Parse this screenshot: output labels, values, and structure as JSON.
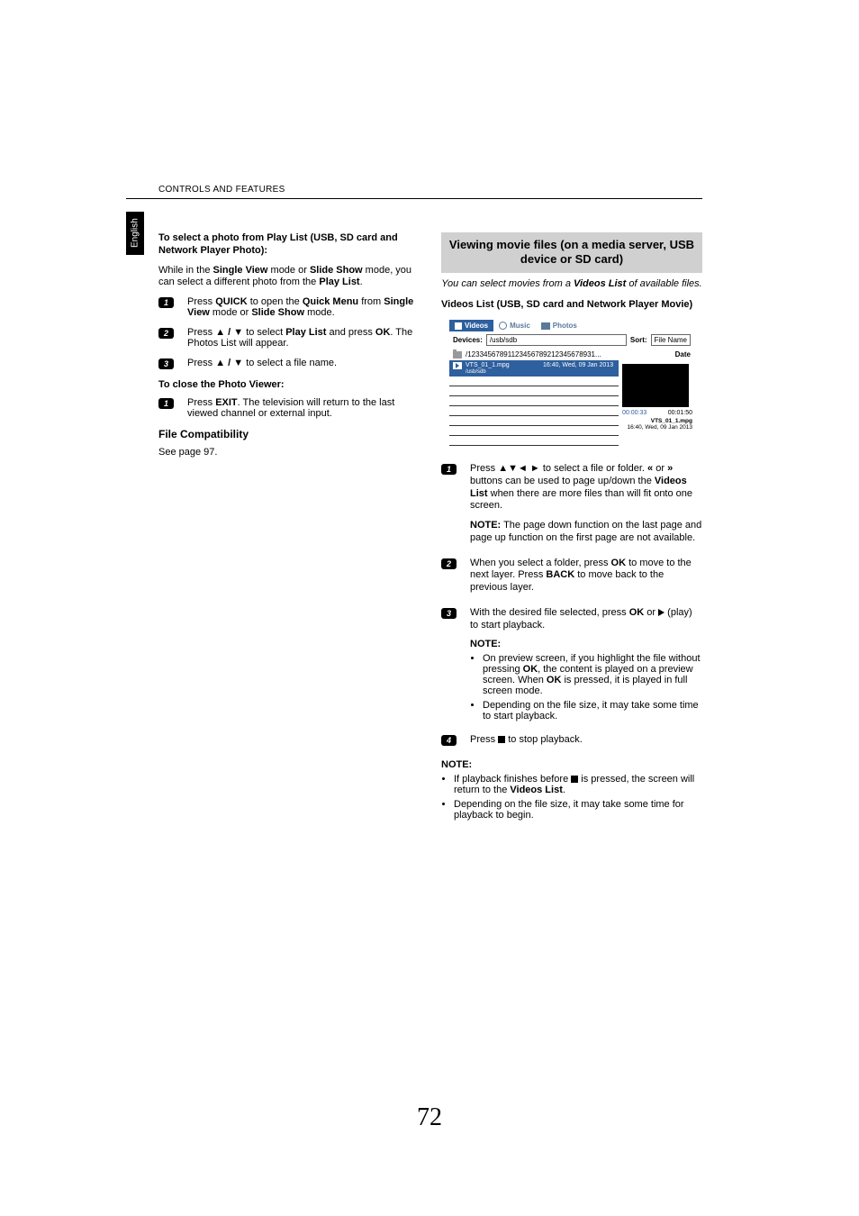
{
  "header": "CONTROLS AND FEATURES",
  "sidetab": "English",
  "page_number": "72",
  "left": {
    "heading": "To select a photo from Play List (USB, SD card and Network Player Photo):",
    "intro_pre": "While in the ",
    "intro_b1": "Single View",
    "intro_mid1": " mode or ",
    "intro_b2": "Slide Show",
    "intro_mid2": " mode, you can select a different photo from the ",
    "intro_b3": "Play List",
    "intro_end": ".",
    "s1_a": "Press ",
    "s1_b": "QUICK",
    "s1_c": " to open the ",
    "s1_d": "Quick Menu",
    "s1_e": " from ",
    "s1_f": "Single View",
    "s1_g": " mode or ",
    "s1_h": "Slide Show",
    "s1_i": " mode.",
    "s2_a": "Press ",
    "s2_arrows": "B / b",
    "s2_b": " to select ",
    "s2_c": "Play List",
    "s2_d": " and press ",
    "s2_e": "OK",
    "s2_f": ". The Photos List will appear.",
    "s3_a": "Press ",
    "s3_arrows": "B / b",
    "s3_b": " to select a file name.",
    "close_h": "To close the Photo Viewer:",
    "close_a": "Press ",
    "close_b": "EXIT",
    "close_c": ". The television will return to the last viewed channel or external input.",
    "fc_h": "File Compatibility",
    "fc_p": "See page 97."
  },
  "right": {
    "section_title": "Viewing movie files (on a media server, USB device or SD card)",
    "ital_a": "You can select movies from a ",
    "ital_b": "Videos List",
    "ital_c": " of available files.",
    "vl_h": "Videos List (USB, SD card and Network Player Movie)",
    "ui": {
      "tab_videos": "Videos",
      "tab_music": "Music",
      "tab_photos": "Photos",
      "devices_label": "Devices:",
      "devices_value": "/usb/sdb",
      "sort_label": "Sort:",
      "sort_value": "File Name",
      "path": "/12334567891123456789212345678931...",
      "date_label": "Date",
      "row_file_top": "VTS_01_1.mpg",
      "row_file_sub": "/usb/sdb",
      "row_date": "16:40, Wed, 09 Jan 2013",
      "time_cur": "00:00:33",
      "time_tot": "00:01:50",
      "meta_name": "VTS_01_1.mpg",
      "meta_date": "16:40, Wed, 09 Jan 2013"
    },
    "s1_a": "Press ",
    "s1_arrows": "BbC c",
    "s1_b": " to select a file or folder. ",
    "s1_c": " or ",
    "s1_d": " buttons can be used to page up/down the ",
    "s1_e": "Videos List",
    "s1_f": " when there are more files than will fit onto one screen.",
    "s1_note_l": "NOTE:",
    "s1_note_t": " The page down function on the last page and page up function on the first page are not available.",
    "s2_a": "When you select a folder, press ",
    "s2_b": "OK",
    "s2_c": " to move to the next layer. Press ",
    "s2_d": "BACK",
    "s2_e": " to move back to the previous layer.",
    "s3_a": "With the desired file selected, press ",
    "s3_b": "OK",
    "s3_c": " or ",
    "s3_d": " (play) to start playback.",
    "s3_note_h": "NOTE:",
    "s3_li1_a": "On preview screen, if you highlight the file without pressing ",
    "s3_li1_b": "OK",
    "s3_li1_c": ", the content is played on a preview screen. When ",
    "s3_li1_d": "OK",
    "s3_li1_e": " is pressed, it is played in full screen mode.",
    "s3_li2": "Depending on the file size, it may take some time to start playback.",
    "s4_a": "Press ",
    "s4_b": " to stop playback.",
    "bottom_note_h": "NOTE:",
    "bottom_li1_a": "If playback finishes before ",
    "bottom_li1_b": " is pressed, the screen will return to the ",
    "bottom_li1_c": "Videos List",
    "bottom_li1_d": ".",
    "bottom_li2": "Depending on the file size, it may take some time for playback to begin."
  }
}
